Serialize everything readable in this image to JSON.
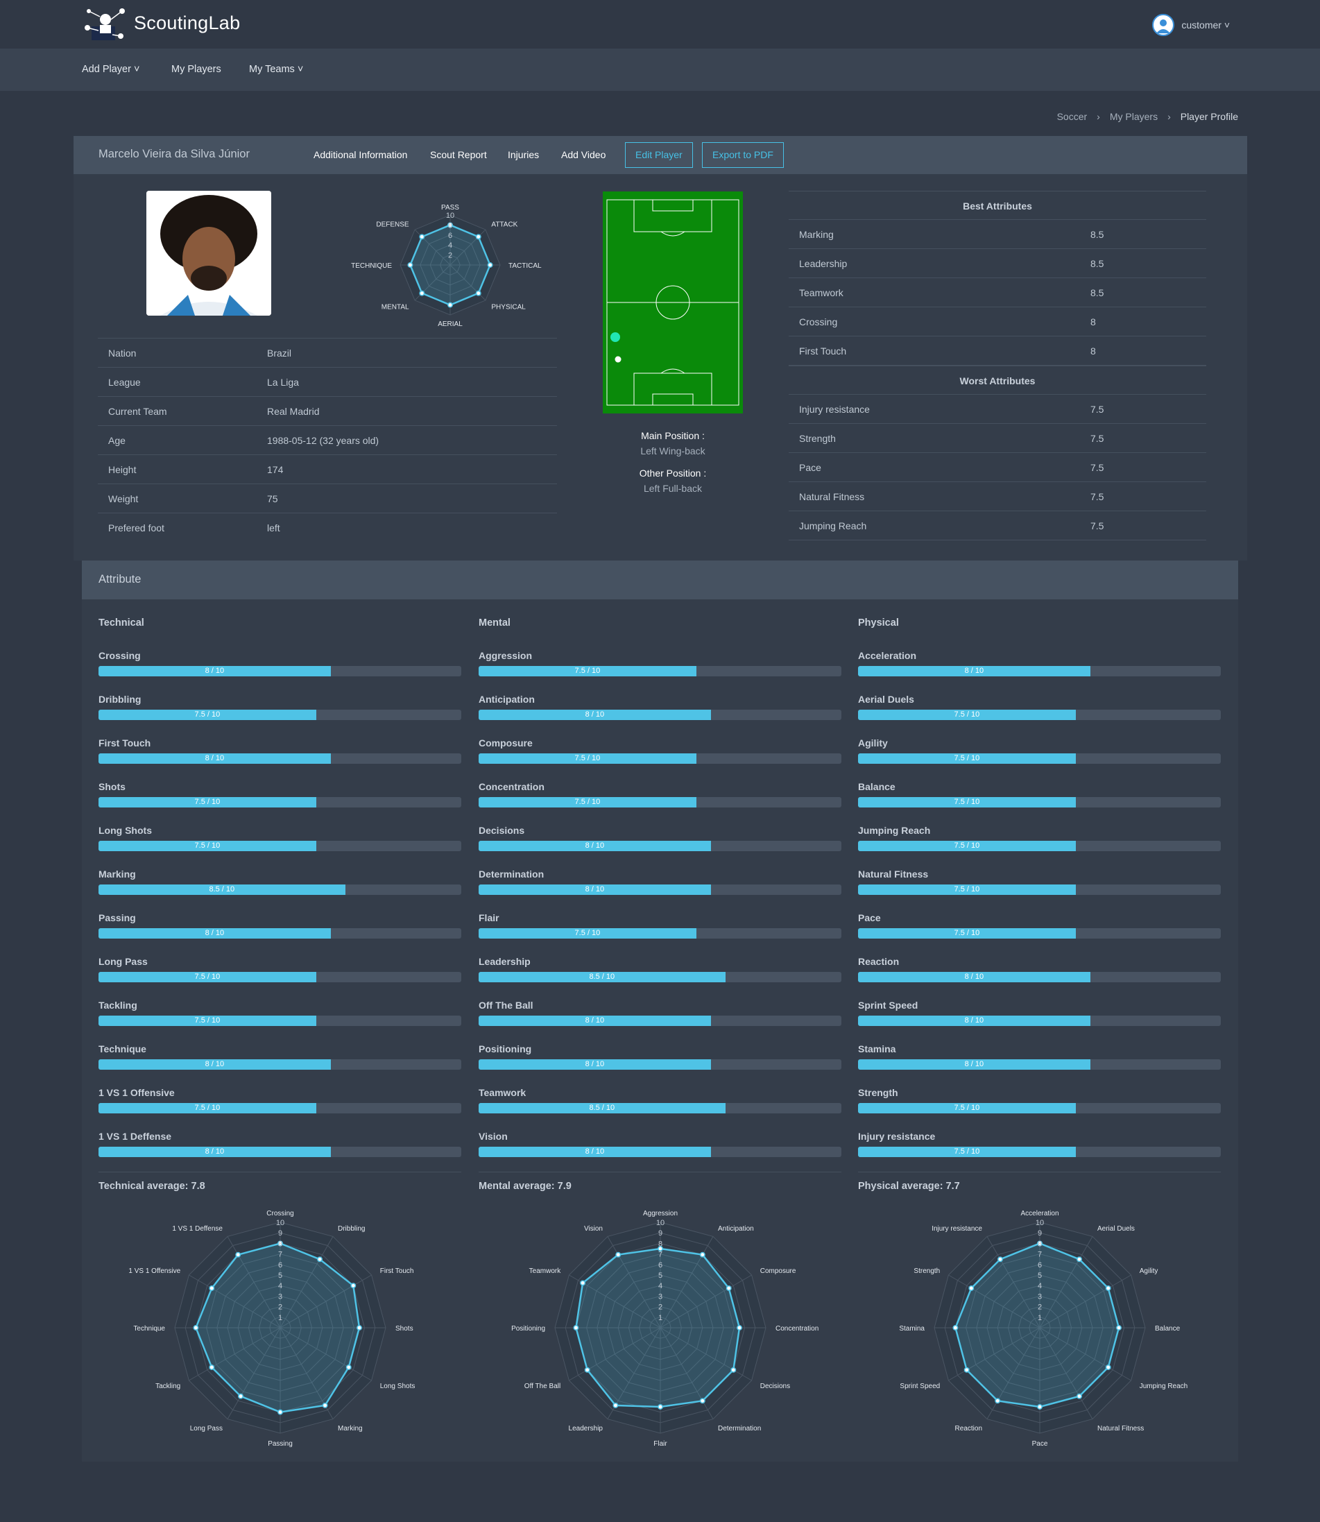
{
  "app": {
    "brand": "ScoutingLab",
    "user": "customer ˅"
  },
  "nav": [
    "Add Player ˅",
    "My Players",
    "My Teams ˅"
  ],
  "breadcrumb": [
    "Soccer",
    "›",
    "My Players",
    "›",
    "Player Profile"
  ],
  "player": {
    "name": "Marcelo Vieira da Silva Júnior",
    "tabs": [
      "Additional Information",
      "Scout Report",
      "Injuries",
      "Add Video"
    ],
    "edit_button": "Edit Player",
    "export_button": "Export to PDF"
  },
  "info": [
    {
      "label": "Nation",
      "value": "Brazil"
    },
    {
      "label": "League",
      "value": "La Liga"
    },
    {
      "label": "Current Team",
      "value": "Real Madrid"
    },
    {
      "label": "Age",
      "value": "1988-05-12 (32 years old)"
    },
    {
      "label": "Height",
      "value": "174"
    },
    {
      "label": "Weight",
      "value": "75"
    },
    {
      "label": "Prefered foot",
      "value": "left"
    }
  ],
  "overview_radar": {
    "axes": [
      "PASS",
      "ATTACK",
      "TACTICAL",
      "PHYSICAL",
      "AERIAL",
      "MENTAL",
      "TECHNIQUE",
      "DEFENSE"
    ],
    "values": [
      8,
      8,
      8,
      8,
      8,
      8,
      8,
      8
    ],
    "ticks": [
      "10",
      "8",
      "6",
      "4",
      "2"
    ]
  },
  "positions": {
    "main_label": "Main Position :",
    "main_value": "Left Wing-back",
    "other_label": "Other Position :",
    "other_value": "Left Full-back"
  },
  "best": {
    "title": "Best Attributes",
    "rows": [
      {
        "label": "Marking",
        "value": "8.5"
      },
      {
        "label": "Leadership",
        "value": "8.5"
      },
      {
        "label": "Teamwork",
        "value": "8.5"
      },
      {
        "label": "Crossing",
        "value": "8"
      },
      {
        "label": "First Touch",
        "value": "8"
      }
    ]
  },
  "worst": {
    "title": "Worst Attributes",
    "rows": [
      {
        "label": "Injury resistance",
        "value": "7.5"
      },
      {
        "label": "Strength",
        "value": "7.5"
      },
      {
        "label": "Pace",
        "value": "7.5"
      },
      {
        "label": "Natural Fitness",
        "value": "7.5"
      },
      {
        "label": "Jumping Reach",
        "value": "7.5"
      }
    ]
  },
  "attribute_section": "Attribute",
  "groups": [
    {
      "title": "Technical",
      "average": "Technical average: 7.8",
      "skills": [
        {
          "name": "Crossing",
          "value": 8,
          "label": "8 / 10"
        },
        {
          "name": "Dribbling",
          "value": 7.5,
          "label": "7.5 / 10"
        },
        {
          "name": "First Touch",
          "value": 8,
          "label": "8 / 10"
        },
        {
          "name": "Shots",
          "value": 7.5,
          "label": "7.5 / 10"
        },
        {
          "name": "Long Shots",
          "value": 7.5,
          "label": "7.5 / 10"
        },
        {
          "name": "Marking",
          "value": 8.5,
          "label": "8.5 / 10"
        },
        {
          "name": "Passing",
          "value": 8,
          "label": "8 / 10"
        },
        {
          "name": "Long Pass",
          "value": 7.5,
          "label": "7.5 / 10"
        },
        {
          "name": "Tackling",
          "value": 7.5,
          "label": "7.5 / 10"
        },
        {
          "name": "Technique",
          "value": 8,
          "label": "8 / 10"
        },
        {
          "name": "1 VS 1 Offensive",
          "value": 7.5,
          "label": "7.5 / 10"
        },
        {
          "name": "1 VS 1 Deffense",
          "value": 8,
          "label": "8 / 10"
        }
      ]
    },
    {
      "title": "Mental",
      "average": "Mental average: 7.9",
      "skills": [
        {
          "name": "Aggression",
          "value": 7.5,
          "label": "7.5 / 10"
        },
        {
          "name": "Anticipation",
          "value": 8,
          "label": "8 / 10"
        },
        {
          "name": "Composure",
          "value": 7.5,
          "label": "7.5 / 10"
        },
        {
          "name": "Concentration",
          "value": 7.5,
          "label": "7.5 / 10"
        },
        {
          "name": "Decisions",
          "value": 8,
          "label": "8 / 10"
        },
        {
          "name": "Determination",
          "value": 8,
          "label": "8 / 10"
        },
        {
          "name": "Flair",
          "value": 7.5,
          "label": "7.5 / 10"
        },
        {
          "name": "Leadership",
          "value": 8.5,
          "label": "8.5 / 10"
        },
        {
          "name": "Off The Ball",
          "value": 8,
          "label": "8 / 10"
        },
        {
          "name": "Positioning",
          "value": 8,
          "label": "8 / 10"
        },
        {
          "name": "Teamwork",
          "value": 8.5,
          "label": "8.5 / 10"
        },
        {
          "name": "Vision",
          "value": 8,
          "label": "8 / 10"
        }
      ]
    },
    {
      "title": "Physical",
      "average": "Physical average: 7.7",
      "skills": [
        {
          "name": "Acceleration",
          "value": 8,
          "label": "8 / 10"
        },
        {
          "name": "Aerial Duels",
          "value": 7.5,
          "label": "7.5 / 10"
        },
        {
          "name": "Agility",
          "value": 7.5,
          "label": "7.5 / 10"
        },
        {
          "name": "Balance",
          "value": 7.5,
          "label": "7.5 / 10"
        },
        {
          "name": "Jumping Reach",
          "value": 7.5,
          "label": "7.5 / 10"
        },
        {
          "name": "Natural Fitness",
          "value": 7.5,
          "label": "7.5 / 10"
        },
        {
          "name": "Pace",
          "value": 7.5,
          "label": "7.5 / 10"
        },
        {
          "name": "Reaction",
          "value": 8,
          "label": "8 / 10"
        },
        {
          "name": "Sprint Speed",
          "value": 8,
          "label": "8 / 10"
        },
        {
          "name": "Stamina",
          "value": 8,
          "label": "8 / 10"
        },
        {
          "name": "Strength",
          "value": 7.5,
          "label": "7.5 / 10"
        },
        {
          "name": "Injury resistance",
          "value": 7.5,
          "label": "7.5 / 10"
        }
      ]
    }
  ],
  "radar_ticks": [
    "10",
    "9",
    "8",
    "7",
    "6",
    "5",
    "4",
    "3",
    "2",
    "1"
  ],
  "colors": {
    "accent": "#4fc3e6",
    "pitch": "#0a8a0a",
    "bg": "#303845"
  }
}
